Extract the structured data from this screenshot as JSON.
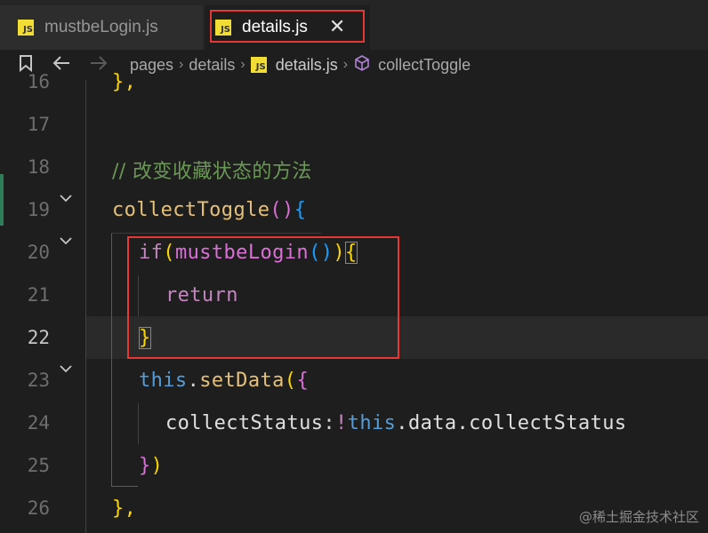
{
  "tabs": [
    {
      "label": "mustbeLogin.js",
      "icon": "js-file-icon"
    },
    {
      "label": "details.js",
      "icon": "js-file-icon",
      "active": true,
      "close": "✕"
    }
  ],
  "js_badge": "JS",
  "breadcrumb": {
    "items": [
      "pages",
      "details",
      "details.js",
      "collectToggle"
    ],
    "separator": "›"
  },
  "line_numbers": [
    "16",
    "17",
    "18",
    "19",
    "20",
    "21",
    "22",
    "23",
    "24",
    "25",
    "26"
  ],
  "current_line": "22",
  "code": {
    "l16": "},",
    "l18": "// 改变收藏状态的方法",
    "l19_fn": "collectToggle",
    "l19_paren": "()",
    "l19_brace": "{",
    "l20_kw": "if",
    "l20_open": "(",
    "l20_fn": "mustbeLogin",
    "l20_call": "()",
    "l20_close": ")",
    "l20_brace": "{",
    "l21": "return",
    "l22": "}",
    "l23_this": "this",
    "l23_dot": ".",
    "l23_fn": "setData",
    "l23_paren": "(",
    "l23_brace": "{",
    "l24_prop": "collectStatus",
    "l24_colon": ":",
    "l24_not": "!",
    "l24_this": "this",
    "l24_rest": ".data.collectStatus",
    "l25_brace": "}",
    "l25_paren": ")",
    "l26": "},"
  },
  "colors": {
    "highlight": "#e53935",
    "comment": "#6a9955",
    "keyword": "#569cd6",
    "function": "#dcdcaa"
  },
  "watermark": "@稀土掘金技术社区"
}
